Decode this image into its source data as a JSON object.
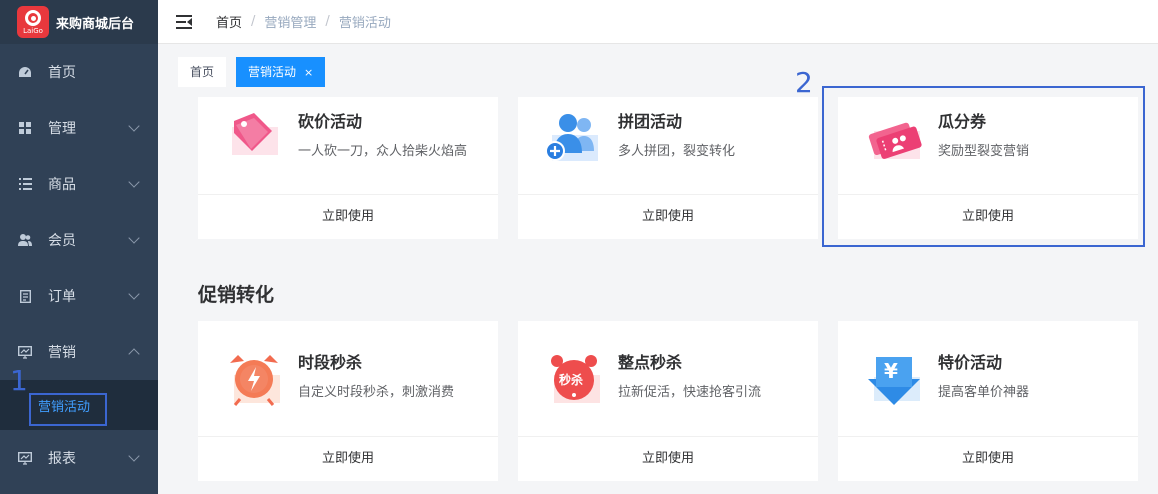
{
  "brand": {
    "logo_text": "LaiGo",
    "title": "来购商城后台"
  },
  "sidebar": {
    "items": [
      {
        "label": "首页",
        "icon": "dashboard-icon",
        "chevron": false
      },
      {
        "label": "管理",
        "icon": "grid-icon",
        "chevron": true
      },
      {
        "label": "商品",
        "icon": "list-icon",
        "chevron": true
      },
      {
        "label": "会员",
        "icon": "users-icon",
        "chevron": true
      },
      {
        "label": "订单",
        "icon": "order-icon",
        "chevron": true
      },
      {
        "label": "营销",
        "icon": "marketing-icon",
        "chevron": true,
        "expanded": true
      },
      {
        "label": "报表",
        "icon": "report-icon",
        "chevron": true
      }
    ],
    "submenu_active": "营销活动"
  },
  "breadcrumb": {
    "home": "首页",
    "level1": "营销管理",
    "level2": "营销活动",
    "separator": "/"
  },
  "tags": {
    "home": "首页",
    "active": "营销活动",
    "close": "×"
  },
  "cards_top": [
    {
      "title": "砍价活动",
      "desc": "一人砍一刀，众人拾柴火焰高",
      "button": "立即使用",
      "icon": "bargain-tag-icon"
    },
    {
      "title": "拼团活动",
      "desc": "多人拼团，裂变转化",
      "button": "立即使用",
      "icon": "group-users-icon"
    },
    {
      "title": "瓜分券",
      "desc": "奖励型裂变营销",
      "button": "立即使用",
      "icon": "coupon-split-icon"
    }
  ],
  "section": {
    "title": "促销转化"
  },
  "cards_bottom": [
    {
      "title": "时段秒杀",
      "desc": "自定义时段秒杀，刺激消费",
      "button": "立即使用",
      "icon": "alarm-clock-icon"
    },
    {
      "title": "整点秒杀",
      "desc": "拉新促活，快速抢客引流",
      "button": "立即使用",
      "icon": "flash-sale-icon",
      "badge": "秒杀"
    },
    {
      "title": "特价活动",
      "desc": "提高客单价神器",
      "button": "立即使用",
      "icon": "yuan-tag-icon",
      "badge": "¥"
    }
  ],
  "annotations": {
    "marker1": "1",
    "marker2": "2"
  },
  "colors": {
    "sidebar_bg": "#304156",
    "accent": "#1890ff",
    "highlight": "#3b66d1",
    "brand_red": "#e8383d"
  }
}
